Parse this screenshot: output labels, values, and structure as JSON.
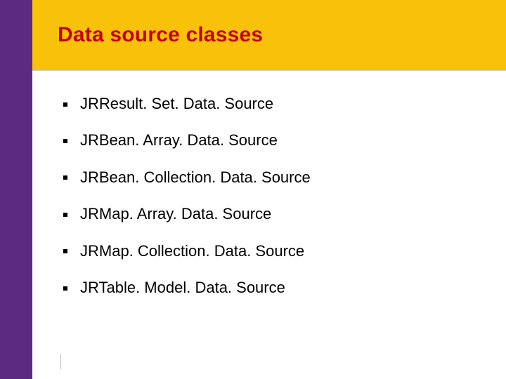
{
  "slide": {
    "title": "Data source classes"
  },
  "bullets": [
    {
      "text": "JRResult. Set. Data. Source"
    },
    {
      "text": "JRBean. Array. Data. Source"
    },
    {
      "text": "JRBean. Collection. Data. Source"
    },
    {
      "text": "JRMap. Array. Data. Source"
    },
    {
      "text": "JRMap. Collection. Data. Source"
    },
    {
      "text": "JRTable. Model. Data. Source"
    }
  ]
}
